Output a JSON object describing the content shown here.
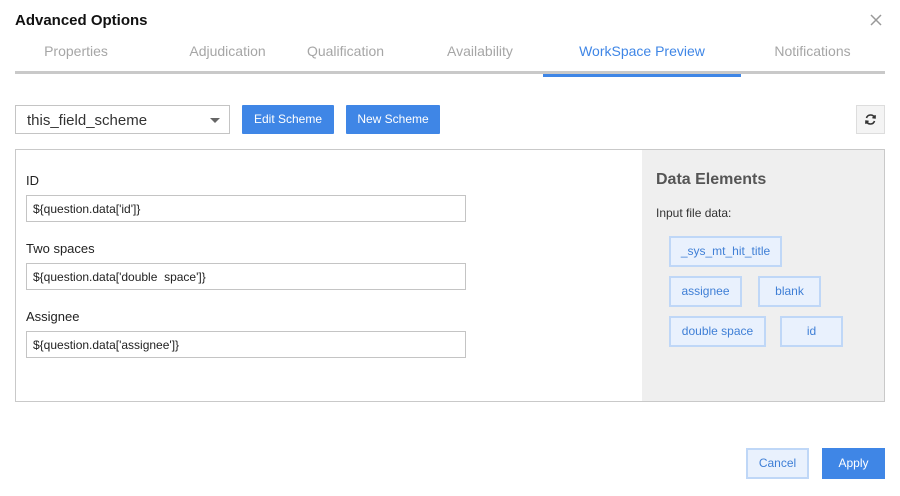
{
  "dialog": {
    "title": "Advanced Options"
  },
  "tabs": [
    {
      "label": "Properties"
    },
    {
      "label": "Adjudication"
    },
    {
      "label": "Qualification"
    },
    {
      "label": "Availability"
    },
    {
      "label": "WorkSpace Preview",
      "active": true
    },
    {
      "label": "Notifications"
    }
  ],
  "toolbar": {
    "scheme_selected": "this_field_scheme",
    "edit_label": "Edit Scheme",
    "new_label": "New Scheme"
  },
  "form": {
    "fields": [
      {
        "label": "ID",
        "value": "${question.data['id']}"
      },
      {
        "label": "Two spaces",
        "value": "${question.data['double  space']}"
      },
      {
        "label": "Assignee",
        "value": "${question.data['assignee']}"
      }
    ]
  },
  "data_elements": {
    "title": "Data Elements",
    "subtitle": "Input file data:",
    "items": [
      "_sys_mt_hit_title",
      "assignee",
      "blank",
      "double space",
      "id"
    ]
  },
  "footer": {
    "cancel_label": "Cancel",
    "apply_label": "Apply"
  },
  "colors": {
    "accent": "#3f86e6",
    "chip_bg": "#e9f1fd",
    "chip_border": "#bfd7f7",
    "panel_bg": "#efefef"
  },
  "icons": {
    "close": "close-icon",
    "caret": "chevron-down-icon",
    "refresh": "refresh-icon"
  }
}
